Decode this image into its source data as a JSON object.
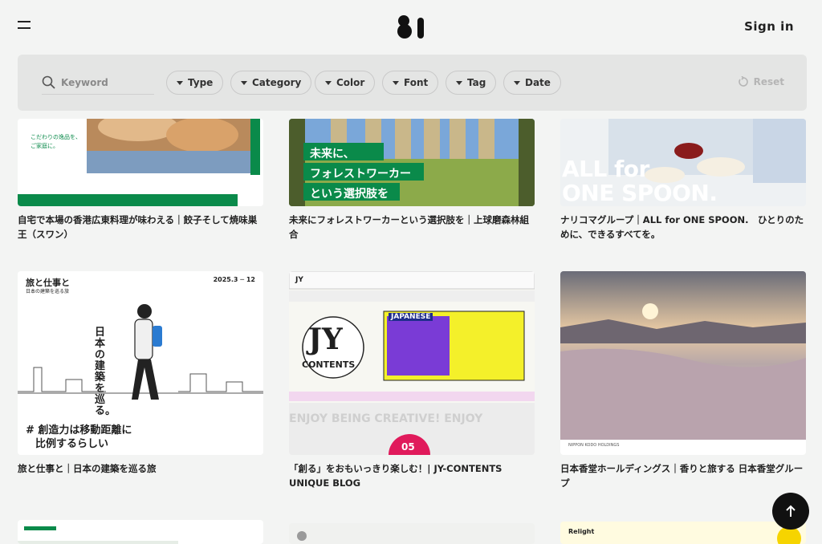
{
  "header": {
    "sign_in": "Sign in"
  },
  "filters": {
    "search_placeholder": "Keyword",
    "chips": [
      "Type",
      "Category",
      "Color",
      "Font",
      "Tag",
      "Date"
    ],
    "reset": "Reset"
  },
  "cards": [
    {
      "caption": "自宅で本場の香港広東料理が味わえる｜餃子そして焼味巣王（スワン）",
      "thumb_text": [
        "こだわりの逸品を、",
        "ご家庭に。"
      ]
    },
    {
      "caption": "未来にフォレストワーカーという選択肢を｜上球磨森林組合",
      "thumb_text": [
        "未来に、",
        "フォレストワーカー",
        "という選択肢を"
      ]
    },
    {
      "caption": "ナリコマグループ｜ALL for ONE SPOON.　ひとりのために、できるすべてを。",
      "thumb_text": [
        "ALL for",
        "ONE SPOON."
      ]
    },
    {
      "caption": "旅と仕事と｜日本の建築を巡る旅",
      "thumb_text": [
        "旅と仕事と",
        "日本の建築を巡る旅",
        "2025.3 ─ 12",
        "日本の建築を巡る。",
        "# 創造力は移動距離に",
        "比例するらしい"
      ]
    },
    {
      "caption": "「創る」をおもいっきり楽しむ！| JY-CONTENTS UNIQUE BLOG",
      "thumb_text": [
        "JY",
        "JY",
        "CONTENTS",
        "JAPANESE",
        "ENJOY BEING CREATIVE! ENJOY",
        "05"
      ]
    },
    {
      "caption": "日本香堂ホールディングス｜香りと旅する 日本香堂グループ",
      "thumb_text": [
        "NIPPON KODO HOLDINGS"
      ]
    },
    {
      "caption": "",
      "thumb_text": []
    },
    {
      "caption": "",
      "thumb_text": []
    },
    {
      "caption": "",
      "thumb_text": [
        "Relight"
      ]
    }
  ],
  "colors": {
    "background": "#f3f4f3",
    "filter_bar": "#e4e5e4",
    "accent_green": "#0a8a4a",
    "scroll_top_bg": "#111111"
  },
  "icons": [
    "menu-icon",
    "logo-icon",
    "search-icon",
    "caret-down-icon",
    "reset-icon",
    "arrow-up-icon"
  ]
}
